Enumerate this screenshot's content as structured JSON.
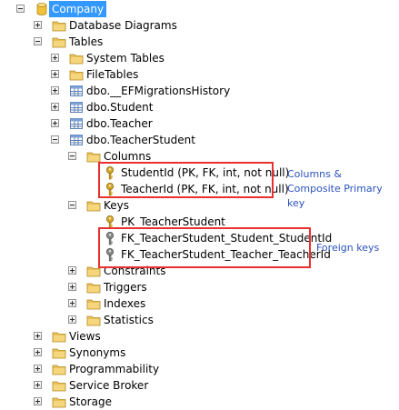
{
  "tree": [
    {
      "id": "company",
      "depth": 0,
      "expander": "minus",
      "icon": "database-icon",
      "label": "Company",
      "selected": true
    },
    {
      "id": "database-diagrams",
      "depth": 1,
      "expander": "plus",
      "icon": "folder-icon",
      "label": "Database Diagrams"
    },
    {
      "id": "tables",
      "depth": 1,
      "expander": "minus",
      "icon": "folder-icon",
      "label": "Tables"
    },
    {
      "id": "system-tables",
      "depth": 2,
      "expander": "plus",
      "icon": "folder-icon",
      "label": "System Tables"
    },
    {
      "id": "filetables",
      "depth": 2,
      "expander": "plus",
      "icon": "folder-icon",
      "label": "FileTables"
    },
    {
      "id": "efmigrationshistory",
      "depth": 2,
      "expander": "plus",
      "icon": "table-icon",
      "label": "dbo.__EFMigrationsHistory"
    },
    {
      "id": "student",
      "depth": 2,
      "expander": "plus",
      "icon": "table-icon",
      "label": "dbo.Student"
    },
    {
      "id": "teacher",
      "depth": 2,
      "expander": "plus",
      "icon": "table-icon",
      "label": "dbo.Teacher"
    },
    {
      "id": "teacherstudent",
      "depth": 2,
      "expander": "minus",
      "icon": "table-icon",
      "label": "dbo.TeacherStudent"
    },
    {
      "id": "columns",
      "depth": 3,
      "expander": "minus",
      "icon": "folder-icon",
      "label": "Columns"
    },
    {
      "id": "col-studentid",
      "depth": 4,
      "expander": "none",
      "icon": "key-gold-icon",
      "label": "StudentId (PK, FK, int, not null)"
    },
    {
      "id": "col-teacherid",
      "depth": 4,
      "expander": "none",
      "icon": "key-gold-icon",
      "label": "TeacherId (PK, FK, int, not null)"
    },
    {
      "id": "keys",
      "depth": 3,
      "expander": "minus",
      "icon": "folder-icon",
      "label": "Keys"
    },
    {
      "id": "pk-teacherstudent",
      "depth": 4,
      "expander": "none",
      "icon": "key-gold-icon",
      "label": "PK_TeacherStudent"
    },
    {
      "id": "fk-student",
      "depth": 4,
      "expander": "none",
      "icon": "key-gray-icon",
      "label": "FK_TeacherStudent_Student_StudentId"
    },
    {
      "id": "fk-teacher",
      "depth": 4,
      "expander": "none",
      "icon": "key-gray-icon",
      "label": "FK_TeacherStudent_Teacher_TeacherId"
    },
    {
      "id": "constraints",
      "depth": 3,
      "expander": "plus",
      "icon": "folder-icon",
      "label": "Constraints"
    },
    {
      "id": "triggers",
      "depth": 3,
      "expander": "plus",
      "icon": "folder-icon",
      "label": "Triggers"
    },
    {
      "id": "indexes",
      "depth": 3,
      "expander": "plus",
      "icon": "folder-icon",
      "label": "Indexes"
    },
    {
      "id": "statistics",
      "depth": 3,
      "expander": "plus",
      "icon": "folder-icon",
      "label": "Statistics"
    },
    {
      "id": "views",
      "depth": 1,
      "expander": "plus",
      "icon": "folder-icon",
      "label": "Views"
    },
    {
      "id": "synonyms",
      "depth": 1,
      "expander": "plus",
      "icon": "folder-icon",
      "label": "Synonyms"
    },
    {
      "id": "programmability",
      "depth": 1,
      "expander": "plus",
      "icon": "folder-icon",
      "label": "Programmability"
    },
    {
      "id": "service-broker",
      "depth": 1,
      "expander": "plus",
      "icon": "folder-icon",
      "label": "Service Broker"
    },
    {
      "id": "storage",
      "depth": 1,
      "expander": "plus",
      "icon": "folder-icon",
      "label": "Storage"
    }
  ],
  "annotations": {
    "columns_note": "Columns & Composite Primary key",
    "foreign_keys_note": "Foreign keys"
  },
  "colors": {
    "selection": "#3399ff",
    "highlight_box": "#e8302f",
    "annotation_text": "#2a52be",
    "folder": "#e8c15a",
    "key_gold": "#d9a928",
    "key_gray": "#8a8a8a"
  }
}
